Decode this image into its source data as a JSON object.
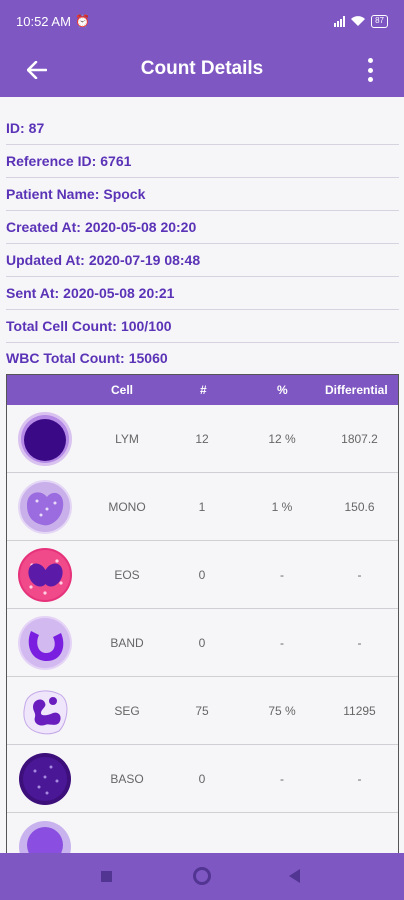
{
  "status_bar": {
    "time": "10:52 AM",
    "battery": "87"
  },
  "app_bar": {
    "title": "Count Details"
  },
  "info": [
    {
      "label": "ID:",
      "value": "87"
    },
    {
      "label": "Reference ID:",
      "value": "6761"
    },
    {
      "label": "Patient Name:",
      "value": "Spock"
    },
    {
      "label": "Created At:",
      "value": "2020-05-08 20:20"
    },
    {
      "label": "Updated At:",
      "value": "2020-07-19 08:48"
    },
    {
      "label": "Sent At:",
      "value": "2020-05-08 20:21"
    },
    {
      "label": "Total Cell Count:",
      "value": "100/100"
    },
    {
      "label": "WBC Total Count:",
      "value": "15060"
    }
  ],
  "table": {
    "headers": {
      "cell": "Cell",
      "num": "#",
      "pct": "%",
      "diff": "Differential"
    },
    "rows": [
      {
        "cell": "LYM",
        "num": "12",
        "pct": "12 %",
        "diff": "1807.2"
      },
      {
        "cell": "MONO",
        "num": "1",
        "pct": "1 %",
        "diff": "150.6"
      },
      {
        "cell": "EOS",
        "num": "0",
        "pct": "-",
        "diff": "-"
      },
      {
        "cell": "BAND",
        "num": "0",
        "pct": "-",
        "diff": "-"
      },
      {
        "cell": "SEG",
        "num": "75",
        "pct": "75 %",
        "diff": "11295"
      },
      {
        "cell": "BASO",
        "num": "0",
        "pct": "-",
        "diff": "-"
      }
    ]
  },
  "colors": {
    "primary": "#7e57c2",
    "text_accent": "#5a33b7"
  }
}
